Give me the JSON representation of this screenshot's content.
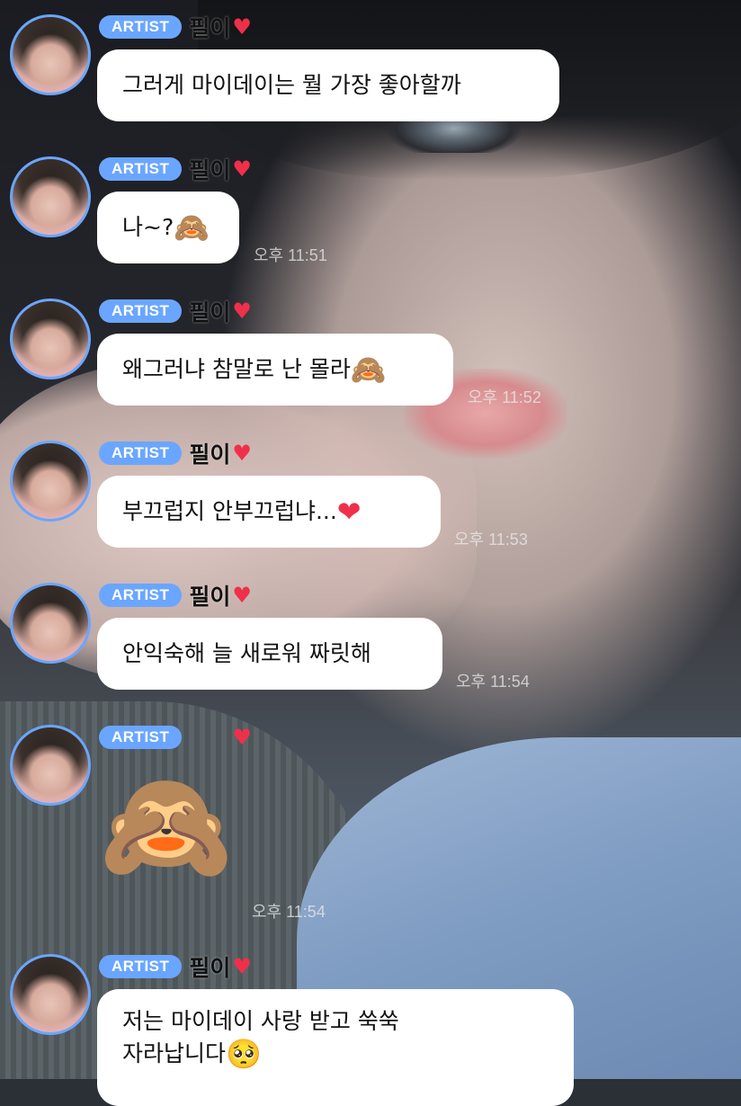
{
  "messages": [
    {
      "badge": "ARTIST",
      "name": "필이",
      "heart": "♥",
      "text": "그러게 마이데이는 뭘 가장 좋아할까",
      "emoji": "",
      "time": ""
    },
    {
      "badge": "ARTIST",
      "name": "필이",
      "heart": "♥",
      "text": "나~?",
      "emoji": "🙈",
      "time": "오후 11:51"
    },
    {
      "badge": "ARTIST",
      "name": "필이",
      "heart": "♥",
      "text": "왜그러냐 참말로 난 몰라",
      "emoji": "🙈",
      "time": "오후 11:52"
    },
    {
      "badge": "ARTIST",
      "name": "필이",
      "heart": "♥",
      "text": "부끄럽지 안부끄럽냐...",
      "emoji": "❤",
      "time": "오후 11:53"
    },
    {
      "badge": "ARTIST",
      "name": "필이",
      "heart": "♥",
      "text": "안익숙해 늘 새로워 짜릿해",
      "emoji": "",
      "time": "오후 11:54"
    },
    {
      "badge": "ARTIST",
      "name": "",
      "heart": "♥",
      "text": "",
      "emoji": "🙈",
      "time": "오후 11:54"
    },
    {
      "badge": "ARTIST",
      "name": "필이",
      "heart": "♥",
      "text": "저는 마이데이 사랑 받고 쑥쑥\n자라납니다",
      "emoji": "🥺",
      "time": ""
    }
  ],
  "colors": {
    "badge": "#6aa6ff",
    "heart": "#f0304a",
    "bubble": "#ffffff"
  },
  "icons": {
    "heart": "heart-icon",
    "avatar": "avatar"
  }
}
